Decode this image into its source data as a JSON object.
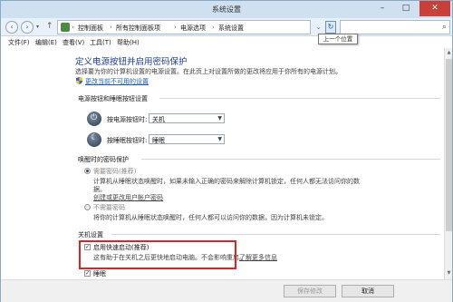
{
  "window": {
    "title": "系统设置",
    "minimize": "–",
    "maximize": "□",
    "close": "✕"
  },
  "address": {
    "crumbs": [
      "控制面板",
      "所有控制面板项",
      "电源选项",
      "系统设置"
    ],
    "separator": "›",
    "search_icon": "⌕",
    "refresh_glyph": "↻",
    "dropdown_glyph": "⌄"
  },
  "tooltip": "上一个位置",
  "menu": [
    "文件(F)",
    "编辑(E)",
    "查看(V)",
    "工具(T)",
    "帮助(H)"
  ],
  "page": {
    "title": "定义电源按钮并启用密码保护",
    "description": "选择要为你的计算机设置的电源设置。在此页上对设置所做的更改将应用于你所有的电源计划。",
    "shield_link": "更改当前不可用的设置"
  },
  "power_section": {
    "title": "电源按钮和睡眠按钮设置",
    "power_label": "按电源按钮时:",
    "power_value": "关机",
    "sleep_label": "按睡眠按钮时:",
    "sleep_value": "睡眠"
  },
  "password_section": {
    "title": "唤醒时的密码保护",
    "option1_label": "需要密码(推荐)",
    "option1_desc1": "计算机从睡眠状态唤醒时，如果未输入正确的密码来解除计算机锁定，任何人都无法访问你的数",
    "option1_desc2": "据。",
    "option1_link": "创建或更改用户帐户密码",
    "option2_label": "不需要密码",
    "option2_desc": "将你的计算机从睡眠状态唤醒时，任何人都可以访问你的数据，因为计算机未锁定。"
  },
  "shutdown_section": {
    "title": "关机设置",
    "fast_startup_label": "启用快速启动(推荐)",
    "fast_startup_desc": "这有助于在关机之后更快地启动电脑。不会影响重启。",
    "fast_startup_link": "了解更多信息",
    "sleep_label": "睡眠"
  },
  "footer": {
    "save": "保存修改",
    "cancel": "取消"
  },
  "colors": {
    "accent_title": "#1e3e8c",
    "link": "#1f5bb5",
    "highlight": "#d92525"
  }
}
